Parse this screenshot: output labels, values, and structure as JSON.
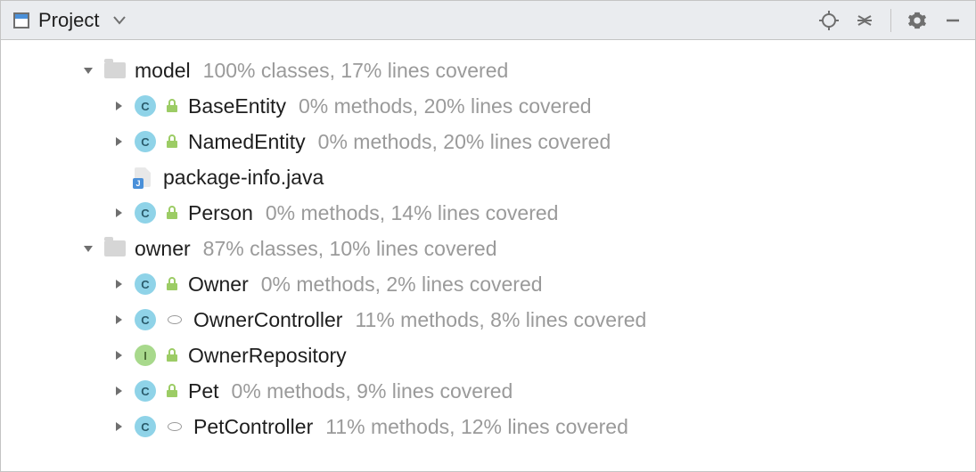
{
  "panel": {
    "title": "Project"
  },
  "tree": [
    {
      "kind": "folder",
      "expanded": true,
      "depth": 0,
      "name": "model",
      "coverage": "100% classes, 17% lines covered",
      "id": "pkg-model"
    },
    {
      "kind": "class",
      "badge": "C",
      "modifier": "lock",
      "expanded": false,
      "hasArrow": true,
      "depth": 1,
      "name": "BaseEntity",
      "coverage": "0% methods, 20% lines covered",
      "id": "class-baseentity"
    },
    {
      "kind": "class",
      "badge": "C",
      "modifier": "lock",
      "expanded": false,
      "hasArrow": true,
      "depth": 1,
      "name": "NamedEntity",
      "coverage": "0% methods, 20% lines covered",
      "id": "class-namedentity"
    },
    {
      "kind": "file",
      "depth": 1,
      "hasArrow": false,
      "name": "package-info.java",
      "id": "file-package-info"
    },
    {
      "kind": "class",
      "badge": "C",
      "modifier": "lock",
      "expanded": false,
      "hasArrow": true,
      "depth": 1,
      "name": "Person",
      "coverage": "0% methods, 14% lines covered",
      "id": "class-person"
    },
    {
      "kind": "folder",
      "expanded": true,
      "depth": 0,
      "name": "owner",
      "coverage": "87% classes, 10% lines covered",
      "id": "pkg-owner"
    },
    {
      "kind": "class",
      "badge": "C",
      "modifier": "lock",
      "expanded": false,
      "hasArrow": true,
      "depth": 1,
      "name": "Owner",
      "coverage": "0% methods, 2% lines covered",
      "id": "class-owner"
    },
    {
      "kind": "class",
      "badge": "C",
      "modifier": "circle",
      "expanded": false,
      "hasArrow": true,
      "depth": 1,
      "name": "OwnerController",
      "coverage": "11% methods, 8% lines covered",
      "id": "class-ownercontroller"
    },
    {
      "kind": "class",
      "badge": "I",
      "modifier": "lock",
      "expanded": false,
      "hasArrow": true,
      "depth": 1,
      "name": "OwnerRepository",
      "id": "class-ownerrepository"
    },
    {
      "kind": "class",
      "badge": "C",
      "modifier": "lock",
      "expanded": false,
      "hasArrow": true,
      "depth": 1,
      "name": "Pet",
      "coverage": "0% methods, 9% lines covered",
      "id": "class-pet"
    },
    {
      "kind": "class",
      "badge": "C",
      "modifier": "circle",
      "expanded": false,
      "hasArrow": true,
      "depth": 1,
      "name": "PetController",
      "coverage": "11% methods, 12% lines covered",
      "id": "class-petcontroller"
    }
  ]
}
